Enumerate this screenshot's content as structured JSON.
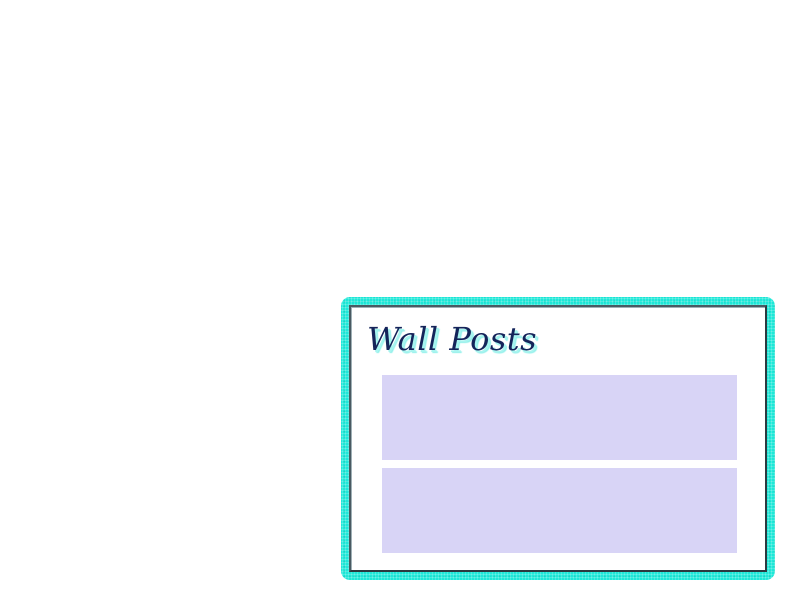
{
  "wall": {
    "title": "Wall Posts",
    "frame_color": "#1ee8d8",
    "post_color": "#d8d4f6",
    "posts": [
      {
        "text": ""
      },
      {
        "text": ""
      }
    ]
  }
}
